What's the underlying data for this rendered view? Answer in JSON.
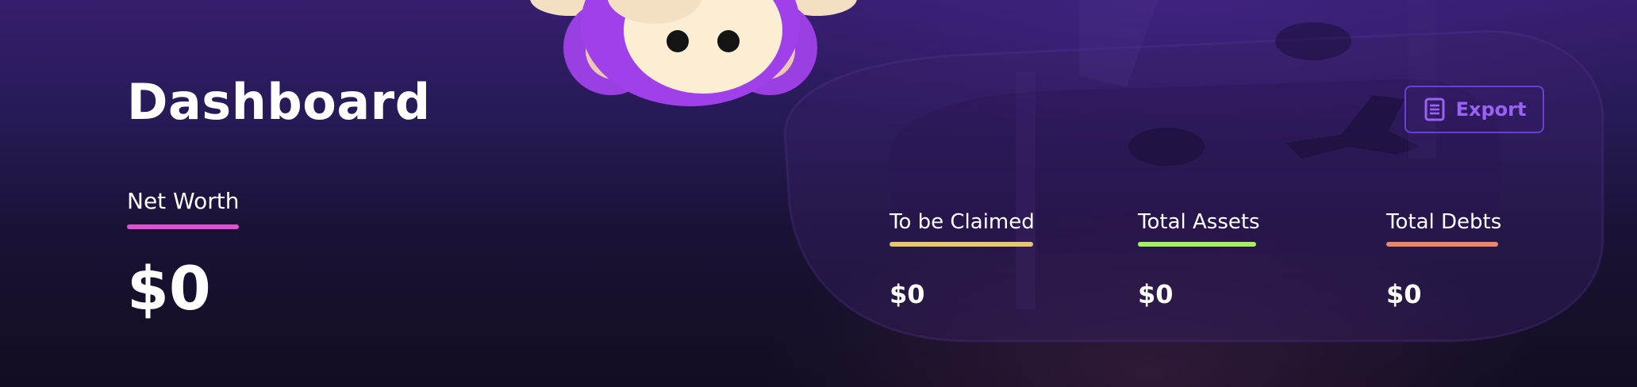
{
  "page": {
    "title": "Dashboard"
  },
  "export": {
    "label": "Export",
    "icon": "document-list-icon"
  },
  "net_worth": {
    "label": "Net Worth",
    "value": "$0",
    "accent": "#e24fd0"
  },
  "metrics": [
    {
      "label": "To be Claimed",
      "value": "$0",
      "accent": "#e9c86a"
    },
    {
      "label": "Total Assets",
      "value": "$0",
      "accent": "#a6f25a"
    },
    {
      "label": "Total Debts",
      "value": "$0",
      "accent": "#f08663"
    }
  ],
  "decorations": {
    "mascot": "monkey-mascot",
    "background_logo": "brand-logo-watermark"
  },
  "colors": {
    "export_accent": "#9a63f5",
    "bg_top": "#361e6e",
    "bg_bottom": "#120d20"
  }
}
